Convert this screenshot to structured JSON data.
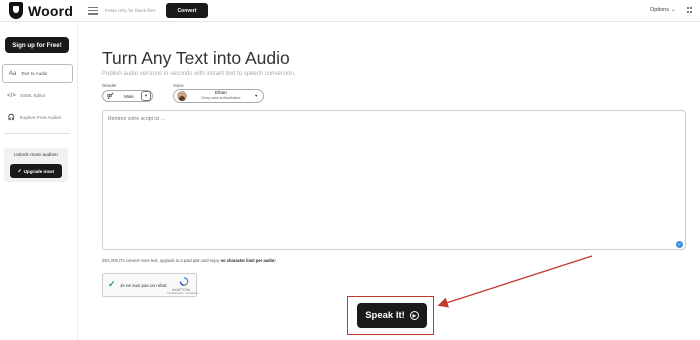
{
  "app": {
    "name": "Woord"
  },
  "topbar": {
    "url_placeholder": "Paste URL for blank files",
    "convert_label": "Convert",
    "options_label": "Options",
    "options_caret": "⌄"
  },
  "sidebar": {
    "signup_label": "Sign up for Free!",
    "items": [
      {
        "icon": "Aa",
        "label": "Text to Audio"
      },
      {
        "icon": "</>",
        "label": "SSML Editor"
      },
      {
        "icon": "🎧",
        "label": "Explore Free Audios"
      }
    ],
    "unlock_title": "Unlock more audios!",
    "upgrade_label": "Upgrade now!"
  },
  "main": {
    "title": "Turn Any Text into Audio",
    "subtitle": "Publish audio versions in seconds with instant text to speech conversion.",
    "gender": {
      "label": "Gender",
      "value": "Male",
      "icon": "⚤",
      "caret": "▾"
    },
    "voice": {
      "label": "Voice",
      "name": "Ethan",
      "description": "Deep and authoritative",
      "caret": "▾"
    },
    "script_placeholder": "Rentrez votre script ici ...",
    "script_check": "✓",
    "char_count_prefix": "29/1,000 (To convert more text, upgrade to a paid plan and enjoy ",
    "char_count_bold": "no character limit per audio",
    "char_count_suffix": ")"
  },
  "recaptcha": {
    "check": "✓",
    "label": "Je ne suis pas un robot",
    "brand": "reCAPTCHA",
    "links": "Confidentialité - Conditions"
  },
  "speak": {
    "label": "Speak It!",
    "icon": "▶"
  },
  "colors": {
    "accent_dark": "#1a1a1a",
    "highlight_red": "#c0392b",
    "check_blue": "#3b8ee0"
  }
}
